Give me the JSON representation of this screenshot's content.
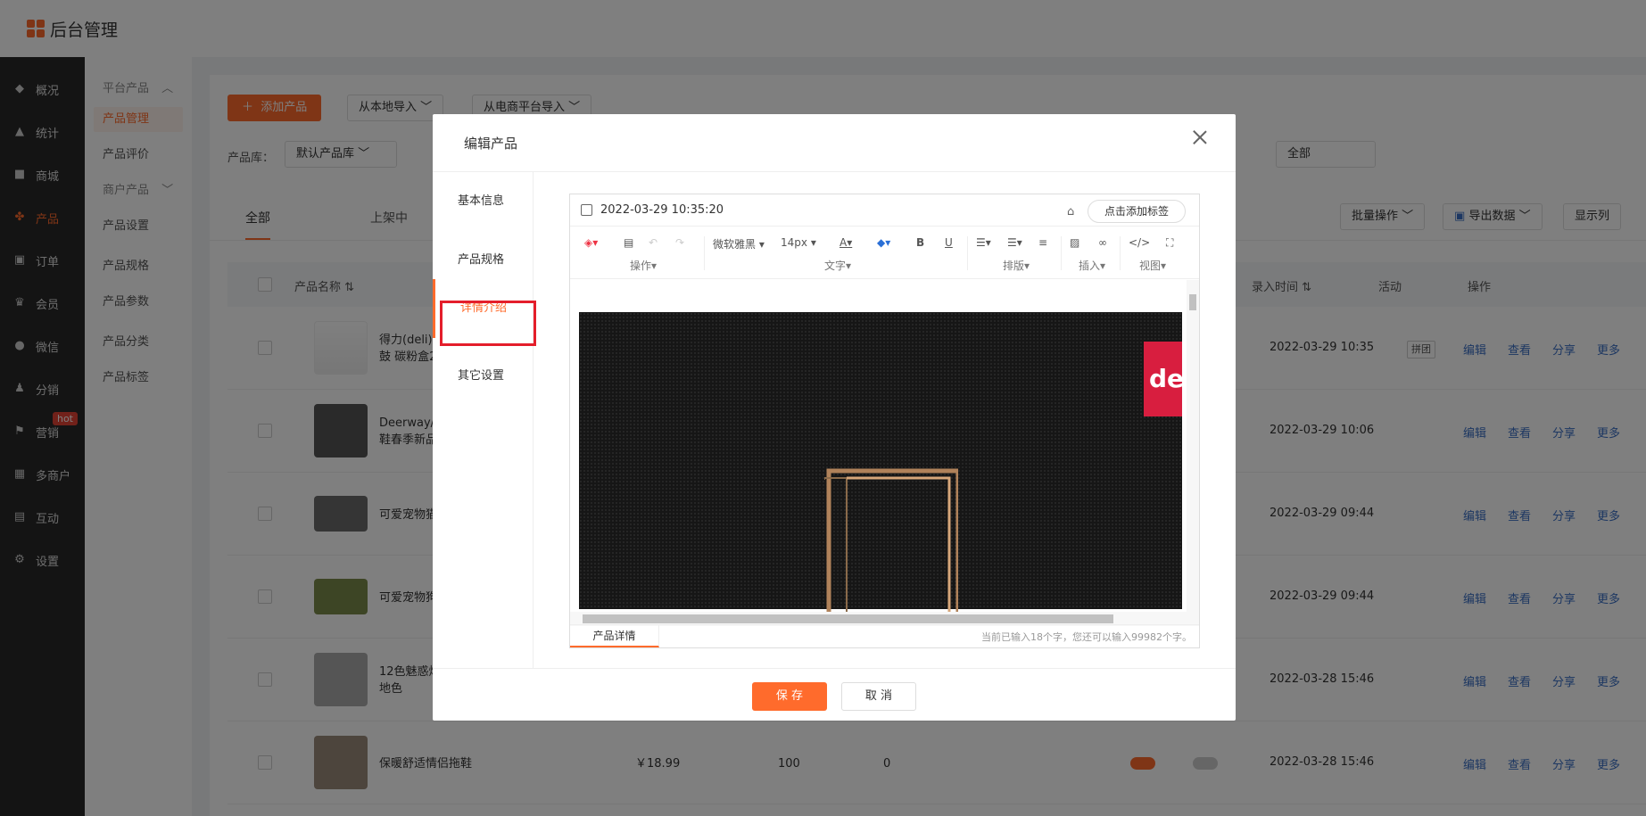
{
  "app": {
    "title": "后台管理"
  },
  "sidebar": {
    "items": [
      {
        "label": "概况",
        "icon": "layers-icon"
      },
      {
        "label": "统计",
        "icon": "chart-icon"
      },
      {
        "label": "商城",
        "icon": "shop-icon"
      },
      {
        "label": "产品",
        "icon": "grid-icon",
        "active": true
      },
      {
        "label": "订单",
        "icon": "order-icon"
      },
      {
        "label": "会员",
        "icon": "crown-icon"
      },
      {
        "label": "微信",
        "icon": "wechat-icon"
      },
      {
        "label": "分销",
        "icon": "users-icon"
      },
      {
        "label": "营销",
        "icon": "flag-icon",
        "badge": "hot"
      },
      {
        "label": "多商户",
        "icon": "apps-icon"
      },
      {
        "label": "互动",
        "icon": "interact-icon"
      },
      {
        "label": "设置",
        "icon": "gear-icon"
      }
    ]
  },
  "subnav": {
    "items": [
      "平台产品",
      "产品管理",
      "产品评价",
      "商户产品",
      "产品设置",
      "产品规格",
      "产品参数",
      "产品分类",
      "产品标签"
    ]
  },
  "toolbar": {
    "add_label": "添加产品",
    "import_local": "从本地导入",
    "import_platform": "从电商平台导入",
    "library_label": "产品库：",
    "library_value": "默认产品库",
    "filter_all": "全部",
    "batch": "批量操作",
    "export": "导出数据",
    "columns": "显示列"
  },
  "tabs": [
    "全部",
    "上架中"
  ],
  "table": {
    "headers": {
      "name": "产品名称",
      "time": "录入时间",
      "activity": "活动",
      "ops": "操作"
    },
    "rows": [
      {
        "name": "得力(deli)DB\n鼓 碳粉盒261",
        "time": "2022-03-29 10:35",
        "tag": "拼团"
      },
      {
        "name": "Deerway/德尔\n鞋春季新品运",
        "time": "2022-03-29 10:06",
        "tag": ""
      },
      {
        "name": "可爱宠物猫猫",
        "time": "2022-03-29 09:44",
        "tag": ""
      },
      {
        "name": "可爱宠物狗狗",
        "time": "2022-03-29 09:44",
        "tag": ""
      },
      {
        "name": "12色魅惑炫色\n地色",
        "time": "2022-03-28 15:46",
        "tag": ""
      },
      {
        "name": "保暖舒适情侣拖鞋",
        "time": "2022-03-28 15:46",
        "tag": "",
        "price": "￥18.99",
        "stock": "100",
        "sales": "0"
      }
    ],
    "actions": [
      "编辑",
      "查看",
      "分享",
      "更多"
    ]
  },
  "modal": {
    "title": "编辑产品",
    "nav": [
      "基本信息",
      "产品规格",
      "详情介绍",
      "其它设置"
    ],
    "editor": {
      "date": "2022-03-29 10:35:20",
      "tag_button": "点击添加标签",
      "font": "微软雅黑",
      "size": "14px",
      "groups": [
        "操作",
        "文字",
        "排版",
        "插入",
        "视图"
      ],
      "brand": "de",
      "foot_tab": "产品详情",
      "count": "当前已输入18个字，您还可以输入99982个字。"
    },
    "save": "保 存",
    "cancel": "取 消"
  },
  "colors": {
    "accent": "#ff6b2c",
    "highlight": "#e41e2b",
    "link": "#3a6fc4"
  }
}
